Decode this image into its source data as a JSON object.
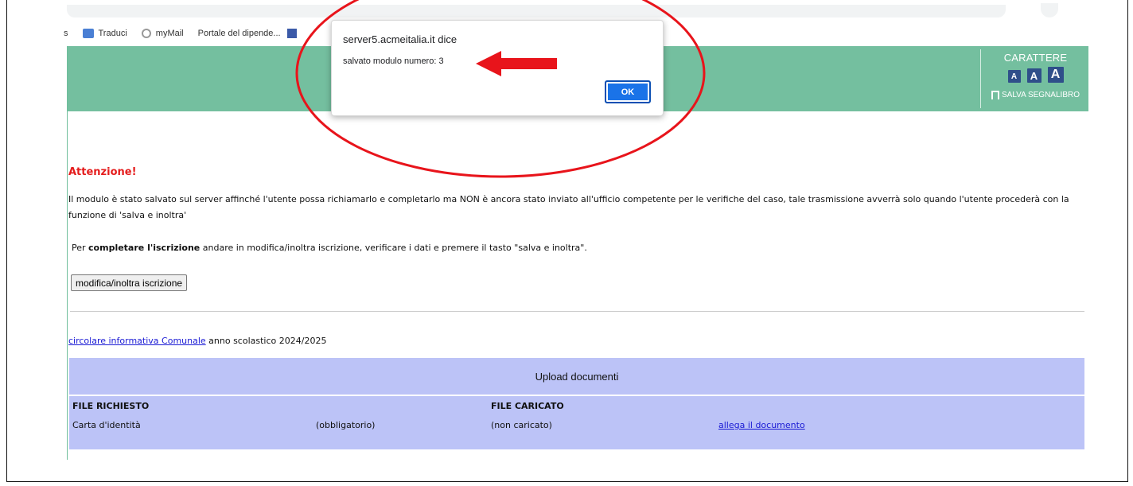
{
  "bookmarks": [
    {
      "label": "s",
      "icon": "none"
    },
    {
      "label": "Traduci",
      "icon": "translate-icon"
    },
    {
      "label": "myMail",
      "icon": "mail-icon"
    },
    {
      "label": "Portale del dipende...",
      "icon": "portal-icon"
    }
  ],
  "header": {
    "font_title": "CARATTERE",
    "font_small": "A",
    "font_medium": "A",
    "font_large": "A",
    "bookmark_label": "SALVA SEGNALIBRO",
    "color": "#74bf9f"
  },
  "dialog": {
    "origin": "server5.acmeitalia.it dice",
    "message": "salvato modulo numero: 3",
    "ok_label": "OK",
    "accent": "#1a73e8"
  },
  "page": {
    "attention": "Attenzione!",
    "notice": "Il modulo è stato salvato sul server affinché l'utente possa richiamarlo e completarlo ma NON è ancora stato inviato all'ufficio competente per le verifiche del caso, tale trasmissione avverrà solo quando l'utente procederà con la funzione di 'salva e inoltra'",
    "complete_prefix": "Per ",
    "complete_bold": "completare l'iscrizione",
    "complete_suffix": " andare in modifica/inoltra iscrizione, verificare i dati e premere il tasto \"salva e inoltra\".",
    "modify_button": "modifica/inoltra iscrizione",
    "circolare_link": "circolare informativa Comunale",
    "circolare_suffix": " anno scolastico 2024/2025"
  },
  "upload": {
    "title": "Upload documenti",
    "col_required": "FILE RICHIESTO",
    "col_uploaded": "FILE CARICATO",
    "rows": [
      {
        "document": "Carta d'identità",
        "requirement": "(obbligatorio)",
        "status": "(non caricato)",
        "action": "allega il documento"
      }
    ],
    "color": "#bcc3f7"
  }
}
